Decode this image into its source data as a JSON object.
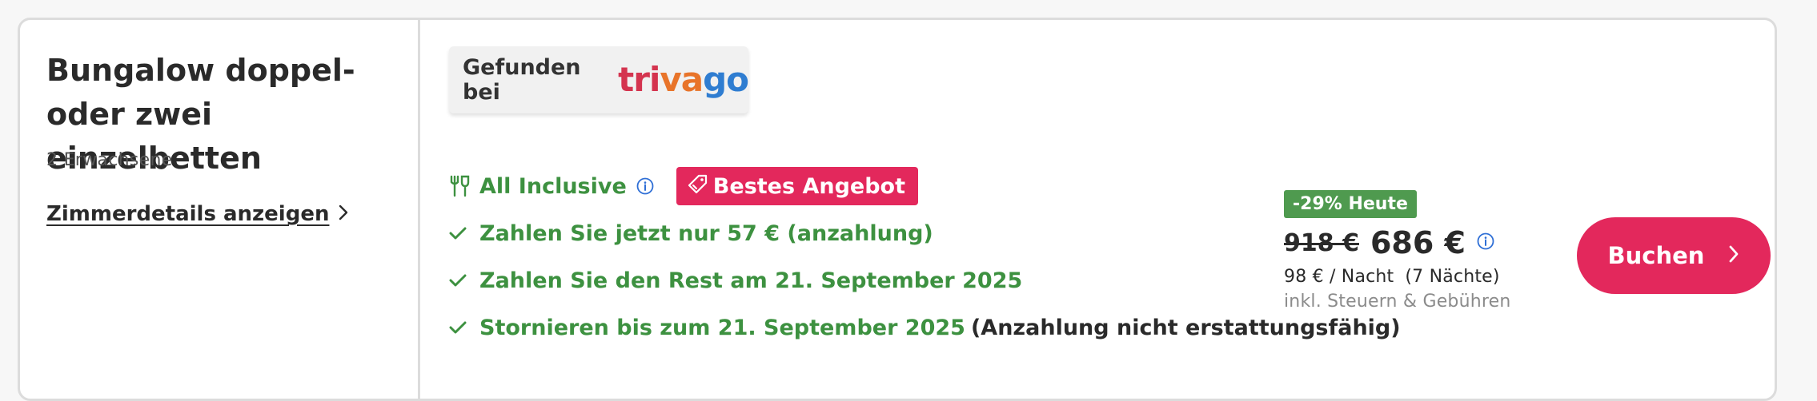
{
  "room": {
    "title": "Bungalow doppel- oder zwei einzelbetten",
    "guests": "2 Erwachsene",
    "details_link": "Zimmerdetails anzeigen"
  },
  "source": {
    "label": "Gefunden bei",
    "logo_parts": [
      "tri",
      "va",
      "go"
    ]
  },
  "features": {
    "board": "All Inclusive",
    "best_badge": "Bestes Angebot",
    "pay_now": "Zahlen Sie jetzt nur 57 € (anzahlung)",
    "pay_rest": "Zahlen Sie den Rest am 21. September 2025",
    "cancel": "Stornieren bis zum 21. September 2025",
    "cancel_note": "(Anzahlung nicht erstattungsfähig)"
  },
  "price": {
    "discount": "-29% Heute",
    "old": "918 €",
    "new": "686 €",
    "per_night": "98 € / Nacht",
    "nights": "(7 Nächte)",
    "taxes": "inkl. Steuern & Gebühren"
  },
  "book_button": "Buchen",
  "colors": {
    "accent": "#e3285c",
    "green": "#3d9140",
    "discount_bg": "#4f9a4f",
    "info_blue": "#2f6fd6"
  },
  "icons": [
    "cutlery-icon",
    "info-icon",
    "tag-icon",
    "check-icon",
    "chevron-right-icon"
  ]
}
